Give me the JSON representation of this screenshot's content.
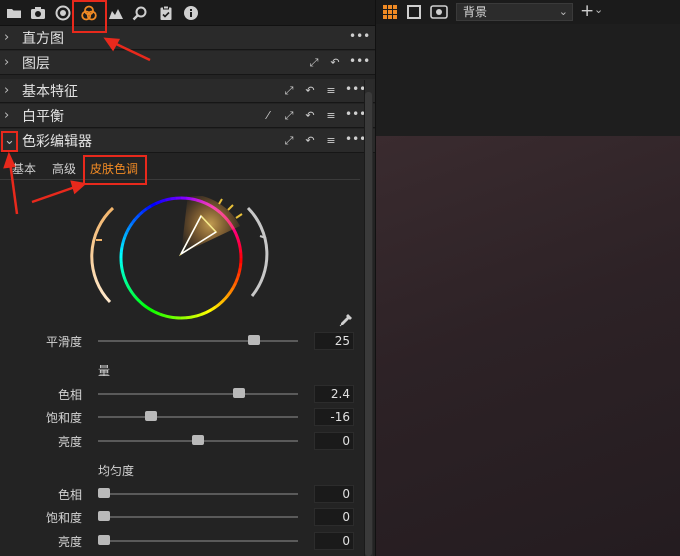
{
  "toolbar": {
    "icons": [
      "folder-icon",
      "camera-icon",
      "lens-icon",
      "color-icon",
      "exposure-icon",
      "search-icon",
      "clipboard-icon",
      "info-icon"
    ],
    "active_icon": "color-icon"
  },
  "sections": {
    "histogram": "直方图",
    "layers": "图层",
    "basic": "基本特征",
    "white_balance": "白平衡",
    "color_editor": "色彩编辑器"
  },
  "tabs": {
    "basic": "基本",
    "advanced": "高级",
    "skin_tone": "皮肤色调"
  },
  "smoothness": {
    "label": "平滑度",
    "value": "25",
    "fraction": 0.8
  },
  "amount": {
    "label": "量",
    "hue": {
      "label": "色相",
      "value": "2.4",
      "fraction": 0.72
    },
    "saturation": {
      "label": "饱和度",
      "value": "-16",
      "fraction": 0.25
    },
    "lightness": {
      "label": "亮度",
      "value": "0",
      "fraction": 0.5
    }
  },
  "uniformity": {
    "label": "均匀度",
    "hue": {
      "label": "色相",
      "value": "0",
      "fraction": 0.0
    },
    "saturation": {
      "label": "饱和度",
      "value": "0",
      "fraction": 0.0
    },
    "lightness": {
      "label": "亮度",
      "value": "0",
      "fraction": 0.0
    }
  },
  "viewer": {
    "variant": "背景"
  },
  "colors": {
    "accent": "#f08a24",
    "annotation": "#e8291c"
  }
}
